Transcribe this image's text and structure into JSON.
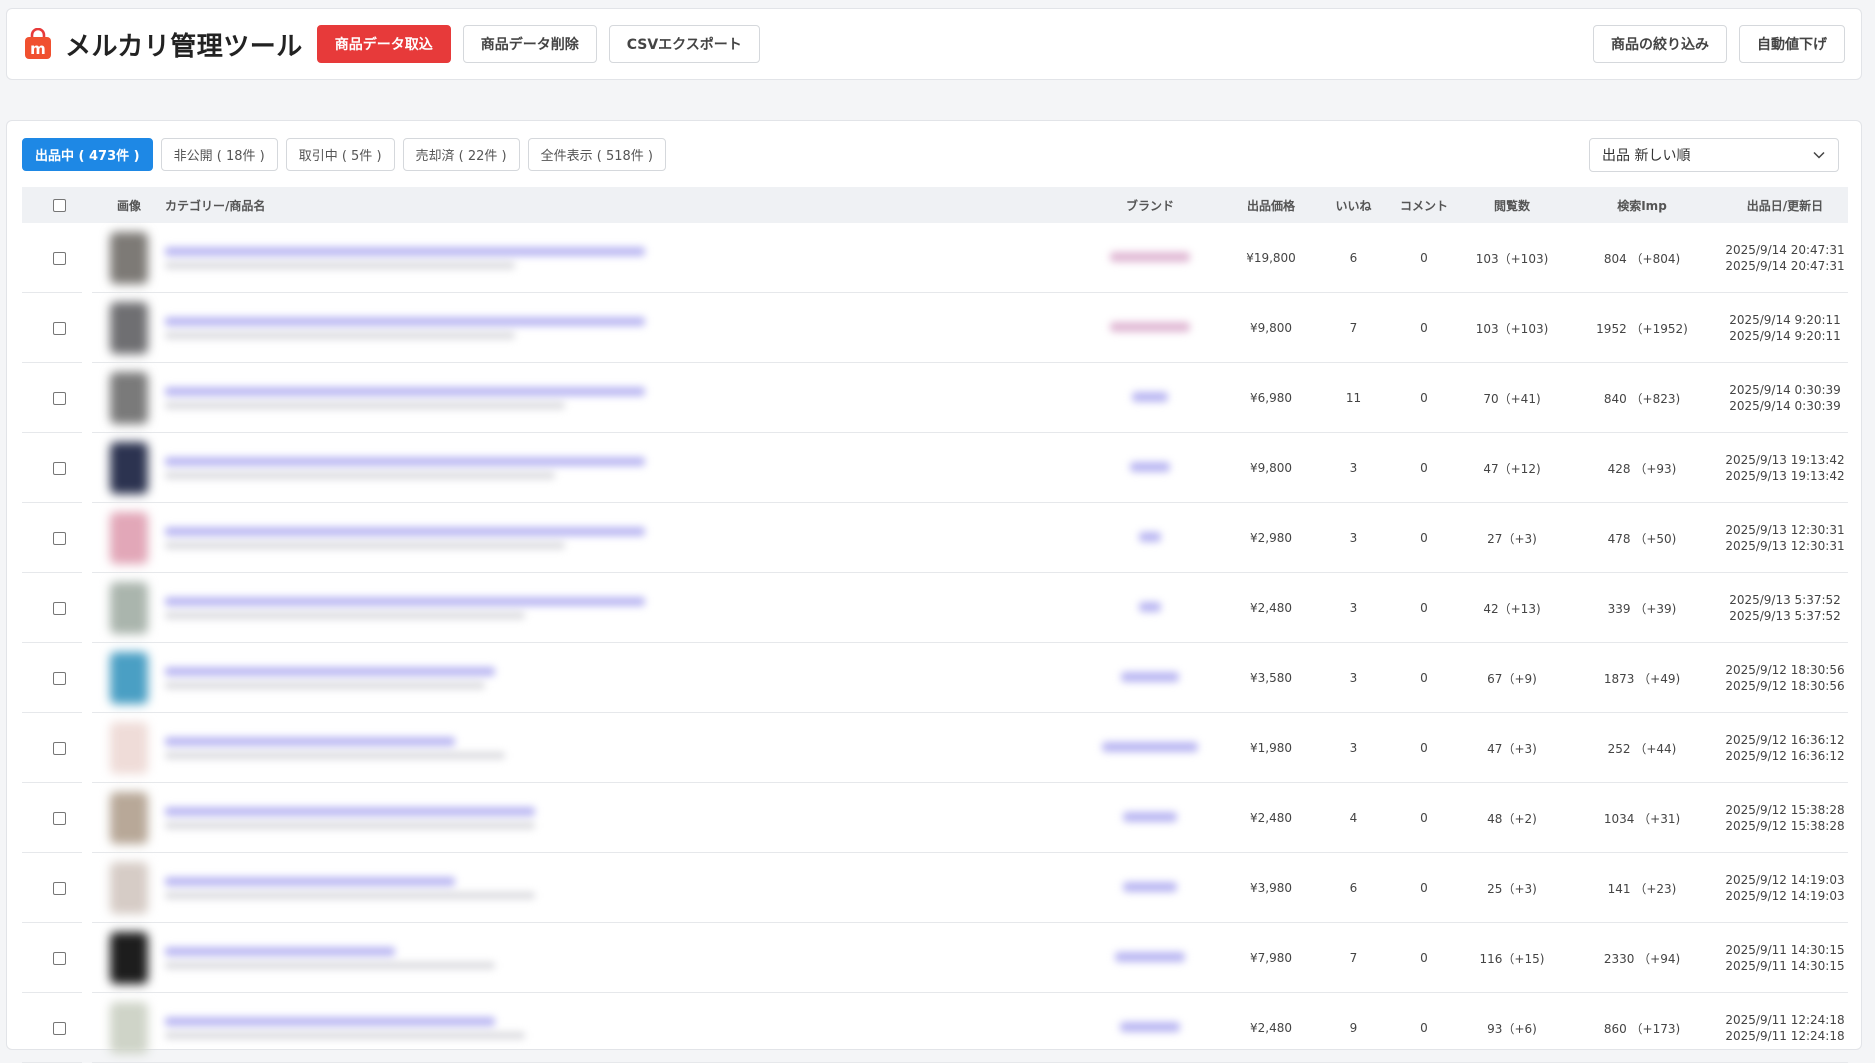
{
  "header": {
    "title": "メルカリ管理ツール",
    "buttons": {
      "import": "商品データ取込",
      "delete": "商品データ削除",
      "export": "CSVエクスポート",
      "filter": "商品の絞り込み",
      "auto_price": "自動値下げ"
    },
    "logo_icon": "mercari-bag-icon",
    "accent_color": "#e73a3a"
  },
  "tabs": [
    {
      "label": "出品中 ( 473件 )",
      "active": true
    },
    {
      "label": "非公開 ( 18件 )",
      "active": false
    },
    {
      "label": "取引中 ( 5件 )",
      "active": false
    },
    {
      "label": "売却済 ( 22件 )",
      "active": false
    },
    {
      "label": "全件表示 ( 518件 )",
      "active": false
    }
  ],
  "sort": {
    "selected": "出品 新しい順"
  },
  "table": {
    "columns": {
      "image": "画像",
      "name": "カテゴリー/商品名",
      "brand": "ブランド",
      "price": "出品価格",
      "likes": "いいね",
      "comments": "コメント",
      "views": "閲覧数",
      "imp": "検索Imp",
      "date": "出品日/更新日"
    },
    "rows": [
      {
        "price": "¥19,800",
        "likes": "6",
        "comments": "0",
        "views": "103（+103)",
        "imp": "804 （+804)",
        "listed": "2025/9/14 20:47:31",
        "updated": "2025/9/14 20:47:31",
        "thumb": "#7d7a76",
        "brand_color": "#e0b8d4",
        "brand_w": 80,
        "l1": 480,
        "l2": 350
      },
      {
        "price": "¥9,800",
        "likes": "7",
        "comments": "0",
        "views": "103（+103)",
        "imp": "1952 （+1952)",
        "listed": "2025/9/14 9:20:11",
        "updated": "2025/9/14 9:20:11",
        "thumb": "#6f6f72",
        "brand_color": "#e0b8d4",
        "brand_w": 80,
        "l1": 480,
        "l2": 350
      },
      {
        "price": "¥6,980",
        "likes": "11",
        "comments": "0",
        "views": "70（+41)",
        "imp": "840 （+823)",
        "listed": "2025/9/14 0:30:39",
        "updated": "2025/9/14 0:30:39",
        "thumb": "#7a7a7a",
        "brand_color": "#b9b6f2",
        "brand_w": 36,
        "l1": 480,
        "l2": 400
      },
      {
        "price": "¥9,800",
        "likes": "3",
        "comments": "0",
        "views": "47（+12)",
        "imp": "428 （+93)",
        "listed": "2025/9/13 19:13:42",
        "updated": "2025/9/13 19:13:42",
        "thumb": "#2c3350",
        "brand_color": "#b9b6f2",
        "brand_w": 40,
        "l1": 480,
        "l2": 390
      },
      {
        "price": "¥2,980",
        "likes": "3",
        "comments": "0",
        "views": "27（+3)",
        "imp": "478 （+50)",
        "listed": "2025/9/13 12:30:31",
        "updated": "2025/9/13 12:30:31",
        "thumb": "#e2a7b8",
        "brand_color": "#b9b6f2",
        "brand_w": 22,
        "l1": 480,
        "l2": 400
      },
      {
        "price": "¥2,480",
        "likes": "3",
        "comments": "0",
        "views": "42（+13)",
        "imp": "339 （+39)",
        "listed": "2025/9/13 5:37:52",
        "updated": "2025/9/13 5:37:52",
        "thumb": "#aab5ad",
        "brand_color": "#b9b6f2",
        "brand_w": 22,
        "l1": 480,
        "l2": 360
      },
      {
        "price": "¥3,580",
        "likes": "3",
        "comments": "0",
        "views": "67（+9)",
        "imp": "1873 （+49)",
        "listed": "2025/9/12 18:30:56",
        "updated": "2025/9/12 18:30:56",
        "thumb": "#4a9fc4",
        "brand_color": "#b9b6f2",
        "brand_w": 58,
        "l1": 330,
        "l2": 320
      },
      {
        "price": "¥1,980",
        "likes": "3",
        "comments": "0",
        "views": "47（+3)",
        "imp": "252 （+44)",
        "listed": "2025/9/12 16:36:12",
        "updated": "2025/9/12 16:36:12",
        "thumb": "#efdcd8",
        "brand_color": "#b9b6f2",
        "brand_w": 96,
        "l1": 290,
        "l2": 340
      },
      {
        "price": "¥2,480",
        "likes": "4",
        "comments": "0",
        "views": "48（+2)",
        "imp": "1034 （+31)",
        "listed": "2025/9/12 15:38:28",
        "updated": "2025/9/12 15:38:28",
        "thumb": "#b8a898",
        "brand_color": "#b9b6f2",
        "brand_w": 54,
        "l1": 370,
        "l2": 370
      },
      {
        "price": "¥3,980",
        "likes": "6",
        "comments": "0",
        "views": "25（+3)",
        "imp": "141 （+23)",
        "listed": "2025/9/12 14:19:03",
        "updated": "2025/9/12 14:19:03",
        "thumb": "#d6ccc6",
        "brand_color": "#b9b6f2",
        "brand_w": 54,
        "l1": 290,
        "l2": 370
      },
      {
        "price": "¥7,980",
        "likes": "7",
        "comments": "0",
        "views": "116（+15)",
        "imp": "2330 （+94)",
        "listed": "2025/9/11 14:30:15",
        "updated": "2025/9/11 14:30:15",
        "thumb": "#1d1d1d",
        "brand_color": "#b9b6f2",
        "brand_w": 70,
        "l1": 230,
        "l2": 330
      },
      {
        "price": "¥2,480",
        "likes": "9",
        "comments": "0",
        "views": "93（+6)",
        "imp": "860 （+173)",
        "listed": "2025/9/11 12:24:18",
        "updated": "2025/9/11 12:24:18",
        "thumb": "#cfd4c8",
        "brand_color": "#b9b6f2",
        "brand_w": 60,
        "l1": 330,
        "l2": 360
      }
    ]
  }
}
